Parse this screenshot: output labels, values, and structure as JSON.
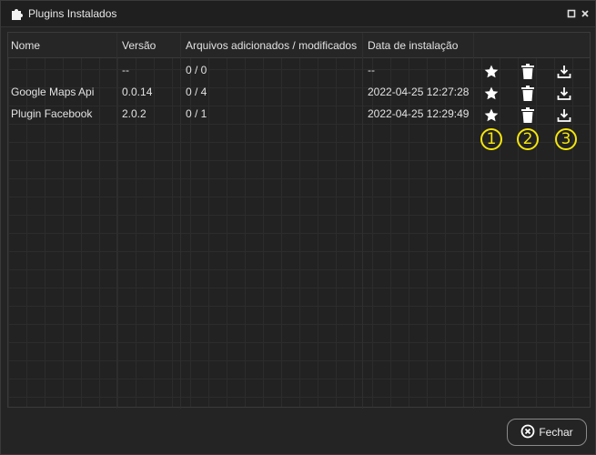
{
  "window": {
    "title": "Plugins Instalados",
    "icon": "puzzle-icon",
    "controls": [
      "maximize-icon",
      "close-icon"
    ]
  },
  "table": {
    "columns": [
      "Nome",
      "Versão",
      "Arquivos adicionados / modificados",
      "Data de instalação"
    ],
    "rows": [
      {
        "name": "",
        "version": "--",
        "files": "0 / 0",
        "date": "--"
      },
      {
        "name": "Google Maps Api",
        "version": "0.0.14",
        "files": "0 / 4",
        "date": "2022-04-25 12:27:28"
      },
      {
        "name": "Plugin Facebook",
        "version": "2.0.2",
        "files": "0 / 1",
        "date": "2022-04-25 12:29:49"
      }
    ],
    "row_actions": [
      "star-icon",
      "trash-icon",
      "download-icon"
    ]
  },
  "callouts": [
    "1",
    "2",
    "3"
  ],
  "footer": {
    "close_label": "Fechar",
    "close_icon": "close-circle-icon"
  },
  "colors": {
    "callout": "#f5e60a",
    "background": "#242424"
  }
}
